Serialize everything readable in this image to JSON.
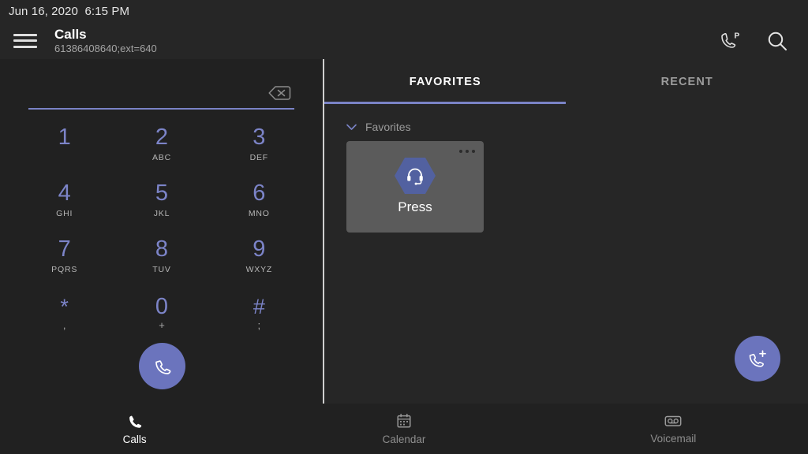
{
  "status_bar": {
    "date": "Jun 16, 2020",
    "time": "6:15 PM",
    "datetime": "Jun 16, 2020  6:15 PM"
  },
  "header": {
    "menu_icon": "hamburger-menu-icon",
    "title": "Calls",
    "subtitle": "61386408640;ext=640",
    "actions": [
      {
        "icon": "call-park-icon",
        "badge": "P"
      },
      {
        "icon": "search-icon"
      }
    ]
  },
  "dialpad": {
    "input_value": "",
    "input_placeholder": "",
    "backspace_icon": "backspace-icon",
    "keys": [
      {
        "digit": "1",
        "letters": ""
      },
      {
        "digit": "2",
        "letters": "ABC"
      },
      {
        "digit": "3",
        "letters": "DEF"
      },
      {
        "digit": "4",
        "letters": "GHI"
      },
      {
        "digit": "5",
        "letters": "JKL"
      },
      {
        "digit": "6",
        "letters": "MNO"
      },
      {
        "digit": "7",
        "letters": "PQRS"
      },
      {
        "digit": "8",
        "letters": "TUV"
      },
      {
        "digit": "9",
        "letters": "WXYZ"
      },
      {
        "digit": "*",
        "letters": ","
      },
      {
        "digit": "0",
        "letters": "+"
      },
      {
        "digit": "#",
        "letters": ";"
      }
    ],
    "call_button_icon": "phone-handset-icon"
  },
  "right_panel": {
    "tabs": [
      {
        "label": "FAVORITES",
        "active": true
      },
      {
        "label": "RECENT",
        "active": false
      }
    ],
    "section": {
      "label": "Favorites",
      "chevron_icon": "chevron-down-icon",
      "expanded": true
    },
    "favorites": [
      {
        "name": "Press",
        "avatar_icon": "headset-icon",
        "overflow_icon": "more-options-icon"
      }
    ],
    "add_button_icon": "add-call-icon"
  },
  "bottom_nav": [
    {
      "label": "Calls",
      "icon": "phone-handset-icon",
      "active": true
    },
    {
      "label": "Calendar",
      "icon": "calendar-icon",
      "active": false
    },
    {
      "label": "Voicemail",
      "icon": "voicemail-tape-icon",
      "active": false
    }
  ],
  "colors": {
    "accent": "#7a83c6",
    "fab": "#6b74bd",
    "avatar": "#5261a0",
    "background": "#212121",
    "panel": "#262626",
    "card": "#5b5b5b"
  }
}
